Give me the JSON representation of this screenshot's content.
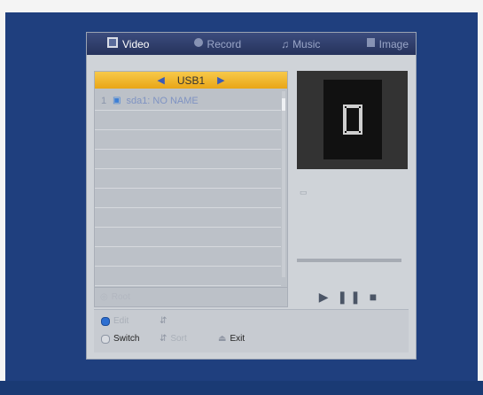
{
  "tabs": [
    {
      "label": "Video",
      "icon": "film-icon",
      "active": true
    },
    {
      "label": "Record",
      "icon": "record-icon",
      "active": false
    },
    {
      "label": "Music",
      "icon": "music-note-icon",
      "active": false
    },
    {
      "label": "Image",
      "icon": "image-icon",
      "active": false
    }
  ],
  "list": {
    "device": "USB1",
    "rows": [
      {
        "index": "1",
        "label": "sda1: NO NAME"
      }
    ],
    "footer": "Root"
  },
  "help": {
    "edit": "Edit",
    "switch": "Switch",
    "sort": "Sort",
    "exit": "Exit"
  }
}
